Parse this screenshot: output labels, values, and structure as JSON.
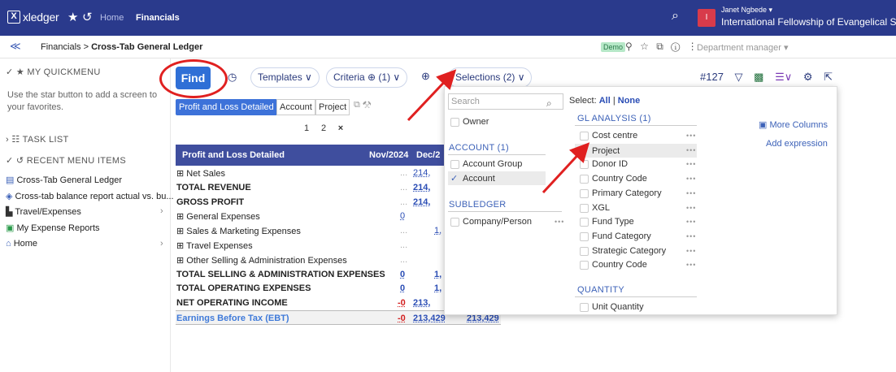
{
  "topbar": {
    "logo_text": "xledger",
    "home_label": "Home",
    "financials_label": "Financials",
    "avatar_letter": "I",
    "user_name": "Janet Ngbede ▾",
    "org_name": "International Fellowship of Evangelical Student"
  },
  "subbar": {
    "breadcrumb_parent": "Financials > ",
    "breadcrumb_current": "Cross-Tab General Ledger",
    "demo_badge": "Demo",
    "department": "Department manager ▾"
  },
  "sidebar": {
    "quickmenu_heading": "✓ ★ MY QUICKMENU",
    "quickmenu_text": "Use the star button to add a screen to your favorites.",
    "tasklist_heading": "› ☷ TASK LIST",
    "recent_heading": "✓ ↺ RECENT MENU ITEMS",
    "recent_items": [
      {
        "label": "Cross-Tab General Ledger"
      },
      {
        "label": "Cross-tab balance report actual vs. bu..."
      },
      {
        "label": "Travel/Expenses"
      },
      {
        "label": "My Expense Reports"
      },
      {
        "label": "Home"
      }
    ]
  },
  "toolbar": {
    "find_label": "Find",
    "templates_label": "Templates ∨",
    "criteria_label": "Criteria ⊕ (1) ∨",
    "selections_label": "Selections (2) ∨",
    "record_number": "#127"
  },
  "tabs": {
    "active": "Profit and Loss Detailed",
    "others": [
      "Account",
      "Project"
    ]
  },
  "pager": {
    "pages": [
      "1",
      "2"
    ],
    "close": "×"
  },
  "ledger": {
    "header": {
      "title": "Profit and Loss Detailed",
      "col1": "Nov/2024",
      "col2": "Dec/2"
    },
    "rows": [
      {
        "label": "⊞ Net Sales",
        "v1": "...",
        "v2": "214,"
      },
      {
        "label": "TOTAL REVENUE",
        "v1": "...",
        "v2": "214,"
      },
      {
        "label": "GROSS PROFIT",
        "v1": "...",
        "v2": "214,"
      },
      {
        "label": "⊞ General Expenses",
        "v1": "0",
        "v2": ""
      },
      {
        "label": "⊞ Sales & Marketing Expenses",
        "v1": "...",
        "v2": "1,"
      },
      {
        "label": "⊞ Travel Expenses",
        "v1": "...",
        "v2": ""
      },
      {
        "label": "⊞ Other Selling & Administration Expenses",
        "v1": "...",
        "v2": ""
      },
      {
        "label": "TOTAL SELLING & ADMINISTRATION EXPENSES",
        "v1": "0",
        "v2": "1,"
      },
      {
        "label": "TOTAL OPERATING EXPENSES",
        "v1": "0",
        "v2": "1,"
      },
      {
        "label": "NET OPERATING INCOME",
        "v1": "-0",
        "v2": "213,"
      }
    ],
    "ebt": {
      "label": "Earnings Before Tax (EBT)",
      "v1": "-0",
      "v2": "213,429",
      "v3": "213,429"
    }
  },
  "dropdown": {
    "search_placeholder": "Search",
    "select_label": "Select:",
    "select_all": "All",
    "select_none": "None",
    "owner": "Owner",
    "account_heading": "ACCOUNT (1)",
    "account_items": [
      "Account Group",
      "Account"
    ],
    "subledger_heading": "SUBLEDGER",
    "subledger_items": [
      "Company/Person"
    ],
    "gl_heading": "GL ANALYSIS (1)",
    "gl_items": [
      "Cost centre",
      "Project",
      "Donor ID",
      "Country Code",
      "Primary Category",
      "XGL",
      "Fund Type",
      "Fund Category",
      "Strategic Category",
      "Country Code"
    ],
    "quantity_heading": "QUANTITY",
    "quantity_items": [
      "Unit Quantity"
    ],
    "more_columns": "More Columns",
    "add_expression": "Add expression"
  },
  "colors": {
    "topbar": "#2a3a8c",
    "accent": "#2f6fd6",
    "highlight_red": "#e02020",
    "table_header": "#3f4e9e"
  }
}
